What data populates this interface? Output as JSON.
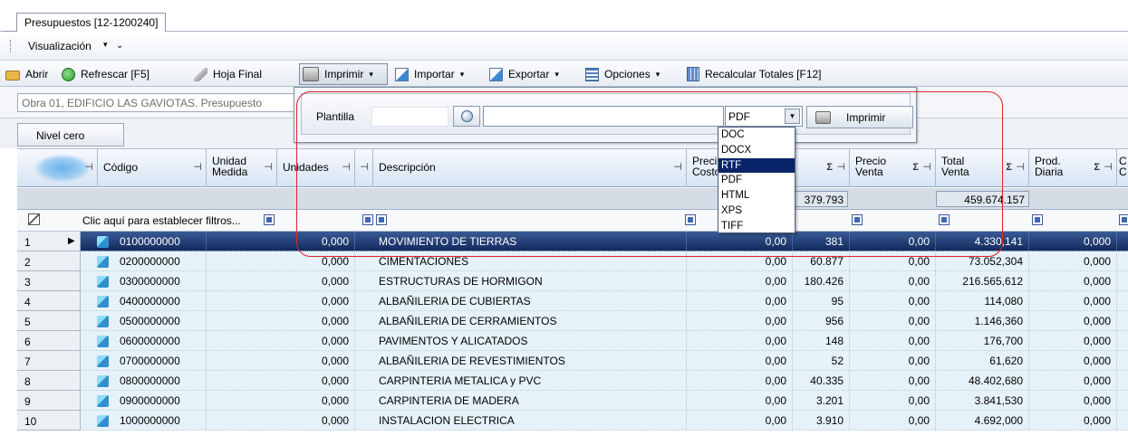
{
  "window": {
    "tab_title": "Presupuestos [12-1200240]"
  },
  "viewbar": {
    "visualizacion": "Visualización",
    "caret": "▾",
    "extra": "⌄"
  },
  "toolbar": {
    "abrir": "Abrir",
    "refrescar": "Refrescar [F5]",
    "hoja_final": "Hoja Final",
    "imprimir": "Imprimir",
    "importar": "Importar",
    "exportar": "Exportar",
    "opciones": "Opciones",
    "recalcular": "Recalcular Totales [F12]",
    "caret": "▾"
  },
  "path": {
    "text": "Obra 01, EDIFICIO LAS GAVIOTAS. Presupuesto"
  },
  "nivel": {
    "label": "Nivel cero"
  },
  "print_popup": {
    "plantilla_label": "Plantilla",
    "format_selected": "PDF",
    "combo_caret": "▾",
    "print_button": "Imprimir",
    "formats": [
      "DOC",
      "DOCX",
      "RTF",
      "PDF",
      "HTML",
      "XPS",
      "TIFF"
    ],
    "highlighted": "RTF"
  },
  "grid": {
    "headers": {
      "codigo": "Código",
      "unidad_medida_1": "Unidad",
      "unidad_medida_2": "Medida",
      "unidades": "Unidades",
      "descripcion": "Descripción",
      "precio_costo_1": "Precio",
      "precio_costo_2": "Costo",
      "precio_venta_1": "Precio",
      "precio_venta_2": "Venta",
      "total_venta_1": "Total",
      "total_venta_2": "Venta",
      "prod_diaria_1": "Prod.",
      "prod_diaria_2": "Diaria",
      "last_1": "C",
      "last_2": "C",
      "pin": "⊣",
      "sigma": "Σ"
    },
    "totals": {
      "total_costo": "379.793",
      "total_venta": "459.674.157"
    },
    "filter_text": "Clic aquí para establecer filtros...",
    "rows": [
      {
        "n": "1",
        "codigo": "0100000000",
        "unidades": "0,000",
        "descripcion": "MOVIMIENTO DE TIERRAS",
        "precio_costo": "0,00",
        "total_costo": "381",
        "precio_venta": "0,00",
        "total_venta": "4.330,141",
        "prod": "0,000"
      },
      {
        "n": "2",
        "codigo": "0200000000",
        "unidades": "0,000",
        "descripcion": "CIMENTACIONES",
        "precio_costo": "0,00",
        "total_costo": "60.877",
        "precio_venta": "0,00",
        "total_venta": "73.052,304",
        "prod": "0,000"
      },
      {
        "n": "3",
        "codigo": "0300000000",
        "unidades": "0,000",
        "descripcion": "ESTRUCTURAS DE HORMIGON",
        "precio_costo": "0,00",
        "total_costo": "180.426",
        "precio_venta": "0,00",
        "total_venta": "216.565,612",
        "prod": "0,000"
      },
      {
        "n": "4",
        "codigo": "0400000000",
        "unidades": "0,000",
        "descripcion": "ALBAÑILERIA DE CUBIERTAS",
        "precio_costo": "0,00",
        "total_costo": "95",
        "precio_venta": "0,00",
        "total_venta": "114,080",
        "prod": "0,000"
      },
      {
        "n": "5",
        "codigo": "0500000000",
        "unidades": "0,000",
        "descripcion": "ALBAÑILERIA DE CERRAMIENTOS",
        "precio_costo": "0,00",
        "total_costo": "956",
        "precio_venta": "0,00",
        "total_venta": "1.146,360",
        "prod": "0,000"
      },
      {
        "n": "6",
        "codigo": "0600000000",
        "unidades": "0,000",
        "descripcion": "PAVIMENTOS Y ALICATADOS",
        "precio_costo": "0,00",
        "total_costo": "148",
        "precio_venta": "0,00",
        "total_venta": "176,700",
        "prod": "0,000"
      },
      {
        "n": "7",
        "codigo": "0700000000",
        "unidades": "0,000",
        "descripcion": "ALBAÑILERIA DE REVESTIMIENTOS",
        "precio_costo": "0,00",
        "total_costo": "52",
        "precio_venta": "0,00",
        "total_venta": "61,620",
        "prod": "0,000"
      },
      {
        "n": "8",
        "codigo": "0800000000",
        "unidades": "0,000",
        "descripcion": "CARPINTERIA METALICA y PVC",
        "precio_costo": "0,00",
        "total_costo": "40.335",
        "precio_venta": "0,00",
        "total_venta": "48.402,680",
        "prod": "0,000"
      },
      {
        "n": "9",
        "codigo": "0900000000",
        "unidades": "0,000",
        "descripcion": "CARPINTERIA DE MADERA",
        "precio_costo": "0,00",
        "total_costo": "3.201",
        "precio_venta": "0,00",
        "total_venta": "3.841,530",
        "prod": "0,000"
      },
      {
        "n": "10",
        "codigo": "1000000000",
        "unidades": "0,000",
        "descripcion": "INSTALACION ELECTRICA",
        "precio_costo": "0,00",
        "total_costo": "3.910",
        "precio_venta": "0,00",
        "total_venta": "4.692,000",
        "prod": "0,000"
      }
    ]
  }
}
